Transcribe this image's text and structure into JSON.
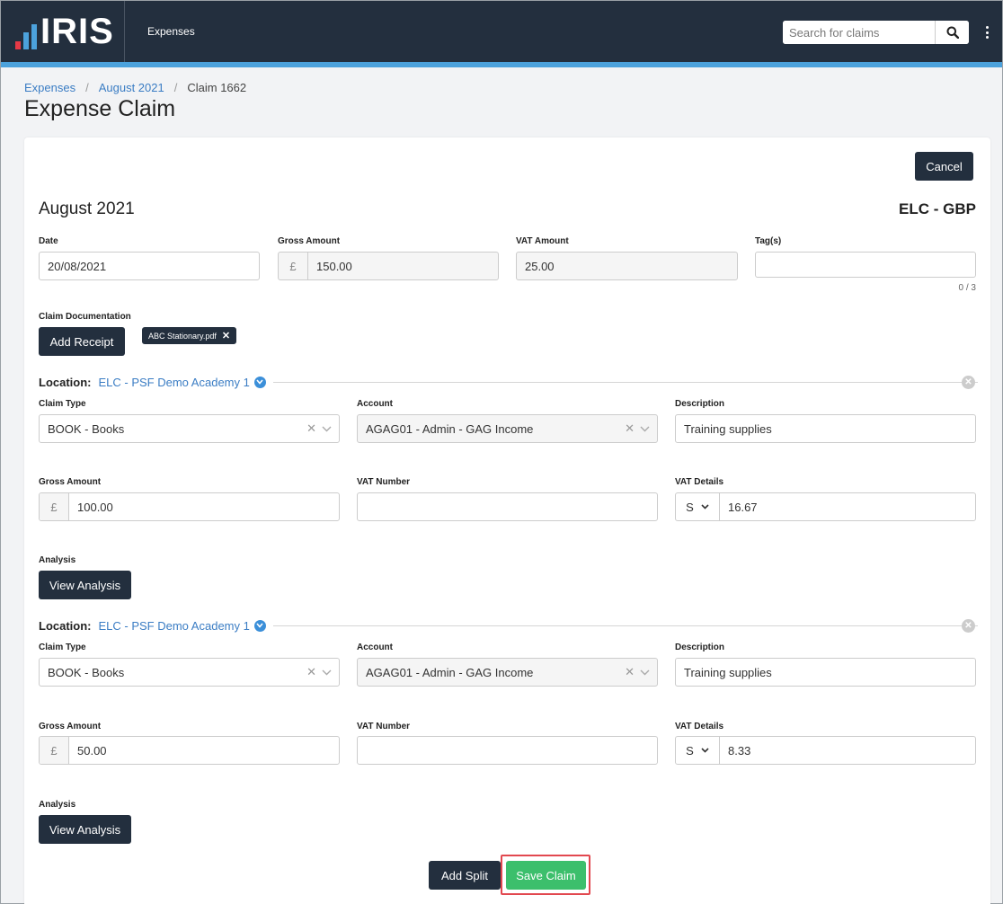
{
  "header": {
    "logo_text": "IRIS",
    "logo_bar_colors": [
      "#e63946",
      "#4ca2dc",
      "#4ca2dc"
    ],
    "nav_label": "Expenses",
    "search_placeholder": "Search for claims"
  },
  "breadcrumb": {
    "items": [
      "Expenses",
      "August 2021"
    ],
    "current": "Claim 1662"
  },
  "page_title": "Expense Claim",
  "claim": {
    "cancel_label": "Cancel",
    "period": "August 2021",
    "currency": "ELC - GBP",
    "date_label": "Date",
    "date_value": "20/08/2021",
    "gross_label": "Gross Amount",
    "currency_symbol": "£",
    "gross_value": "150.00",
    "vat_label": "VAT Amount",
    "vat_value": "25.00",
    "tags_label": "Tag(s)",
    "tags_value": "",
    "tags_counter": "0 / 3",
    "documentation_label": "Claim Documentation",
    "add_receipt_label": "Add Receipt",
    "attachment_name": "ABC Stationary.pdf"
  },
  "splits": [
    {
      "location_label": "Location:",
      "location_value": "ELC - PSF Demo Academy 1",
      "claim_type_label": "Claim Type",
      "claim_type_value": "BOOK - Books",
      "account_label": "Account",
      "account_value": "AGAG01 - Admin - GAG Income",
      "description_label": "Description",
      "description_value": "Training supplies",
      "gross_label": "Gross Amount",
      "gross_value": "100.00",
      "vat_number_label": "VAT Number",
      "vat_number_value": "",
      "vat_details_label": "VAT Details",
      "vat_code": "S",
      "vat_amount": "16.67",
      "analysis_label": "Analysis",
      "view_analysis_label": "View Analysis"
    },
    {
      "location_label": "Location:",
      "location_value": "ELC - PSF Demo Academy 1",
      "claim_type_label": "Claim Type",
      "claim_type_value": "BOOK - Books",
      "account_label": "Account",
      "account_value": "AGAG01 - Admin - GAG Income",
      "description_label": "Description",
      "description_value": "Training supplies",
      "gross_label": "Gross Amount",
      "gross_value": "50.00",
      "vat_number_label": "VAT Number",
      "vat_number_value": "",
      "vat_details_label": "VAT Details",
      "vat_code": "S",
      "vat_amount": "8.33",
      "analysis_label": "Analysis",
      "view_analysis_label": "View Analysis"
    }
  ],
  "footer": {
    "add_split_label": "Add Split",
    "save_claim_label": "Save Claim"
  },
  "colors": {
    "navbar": "#232f3e",
    "accent": "#4ca2dc",
    "save": "#3cbf6c",
    "highlight": "#e2484f"
  }
}
